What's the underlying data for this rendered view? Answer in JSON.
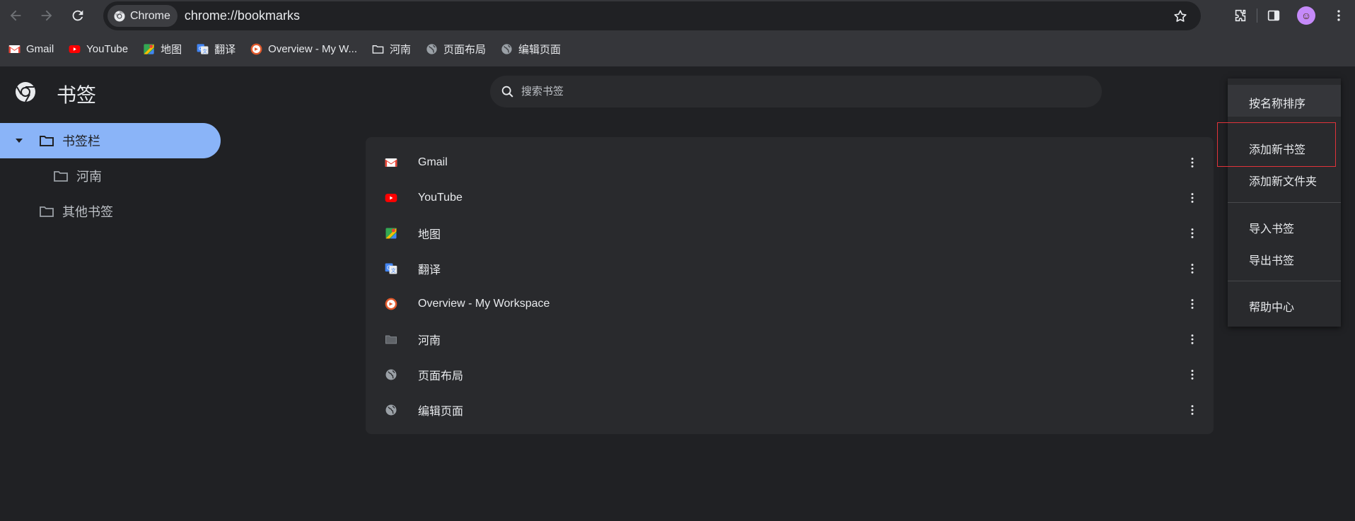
{
  "browser": {
    "chip_label": "Chrome",
    "url": "chrome://bookmarks"
  },
  "bookmarks_bar": [
    {
      "label": "Gmail",
      "icon": "gmail-icon"
    },
    {
      "label": "YouTube",
      "icon": "youtube-icon"
    },
    {
      "label": "地图",
      "icon": "maps-icon"
    },
    {
      "label": "翻译",
      "icon": "translate-icon"
    },
    {
      "label": "Overview - My W...",
      "icon": "workspace-icon"
    },
    {
      "label": "河南",
      "icon": "folder-icon"
    },
    {
      "label": "页面布局",
      "icon": "globe-icon"
    },
    {
      "label": "编辑页面",
      "icon": "globe-icon"
    }
  ],
  "page": {
    "title": "书签",
    "search_placeholder": "搜索书签"
  },
  "sidebar": {
    "items": [
      {
        "label": "书签栏",
        "selected": true
      },
      {
        "label": "河南"
      },
      {
        "label": "其他书签"
      }
    ]
  },
  "list": [
    {
      "title": "Gmail",
      "icon": "gmail-icon"
    },
    {
      "title": "YouTube",
      "icon": "youtube-icon"
    },
    {
      "title": "地图",
      "icon": "maps-icon"
    },
    {
      "title": "翻译",
      "icon": "translate-icon"
    },
    {
      "title": "Overview - My Workspace",
      "icon": "workspace-icon"
    },
    {
      "title": "河南",
      "icon": "folder-icon"
    },
    {
      "title": "页面布局",
      "icon": "globe-icon"
    },
    {
      "title": "编辑页面",
      "icon": "globe-icon"
    }
  ],
  "menu": {
    "items": [
      "按名称排序",
      "添加新书签",
      "添加新文件夹",
      "导入书签",
      "导出书签",
      "帮助中心"
    ]
  },
  "colors": {
    "accent": "#8ab4f8",
    "background": "#202124",
    "toolbar": "#35363a",
    "highlight": "#e0333a"
  }
}
